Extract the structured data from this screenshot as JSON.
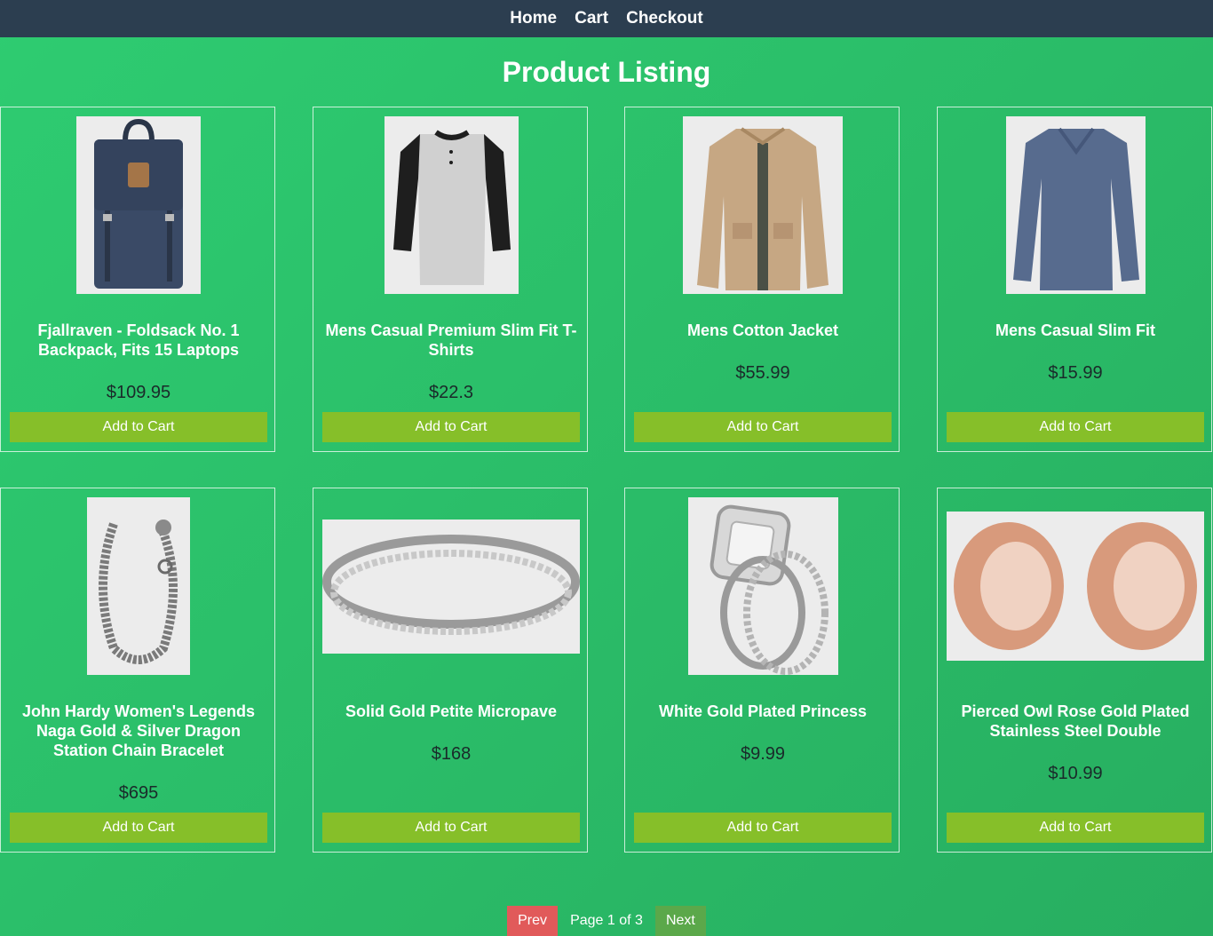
{
  "nav": {
    "home": "Home",
    "cart": "Cart",
    "checkout": "Checkout"
  },
  "page": {
    "title": "Product Listing"
  },
  "products": [
    {
      "title": "Fjallraven - Foldsack No. 1 Backpack, Fits 15 Laptops",
      "price": "$109.95",
      "button": "Add to Cart",
      "icon": "backpack-image"
    },
    {
      "title": "Mens Casual Premium Slim Fit T-Shirts",
      "price": "$22.3",
      "button": "Add to Cart",
      "icon": "tshirt-image"
    },
    {
      "title": "Mens Cotton Jacket",
      "price": "$55.99",
      "button": "Add to Cart",
      "icon": "jacket-image"
    },
    {
      "title": "Mens Casual Slim Fit",
      "price": "$15.99",
      "button": "Add to Cart",
      "icon": "longsleeve-image"
    },
    {
      "title": "John Hardy Women's Legends Naga Gold & Silver Dragon Station Chain Bracelet",
      "price": "$695",
      "button": "Add to Cart",
      "icon": "bracelet-image"
    },
    {
      "title": "Solid Gold Petite Micropave",
      "price": "$168",
      "button": "Add to Cart",
      "icon": "ring-image"
    },
    {
      "title": "White Gold Plated Princess",
      "price": "$9.99",
      "button": "Add to Cart",
      "icon": "princess-ring-image"
    },
    {
      "title": "Pierced Owl Rose Gold Plated Stainless Steel Double",
      "price": "$10.99",
      "button": "Add to Cart",
      "icon": "earring-tunnels-image"
    }
  ],
  "pagination": {
    "prev": "Prev",
    "info": "Page 1 of 3",
    "next": "Next"
  },
  "colors": {
    "nav_bg": "#2c3e50",
    "page_bg_start": "#2ecc71",
    "page_bg_end": "#27ae60",
    "add_button": "#86bf29",
    "prev_button": "#e15a5a",
    "next_button": "#5ba84a"
  }
}
